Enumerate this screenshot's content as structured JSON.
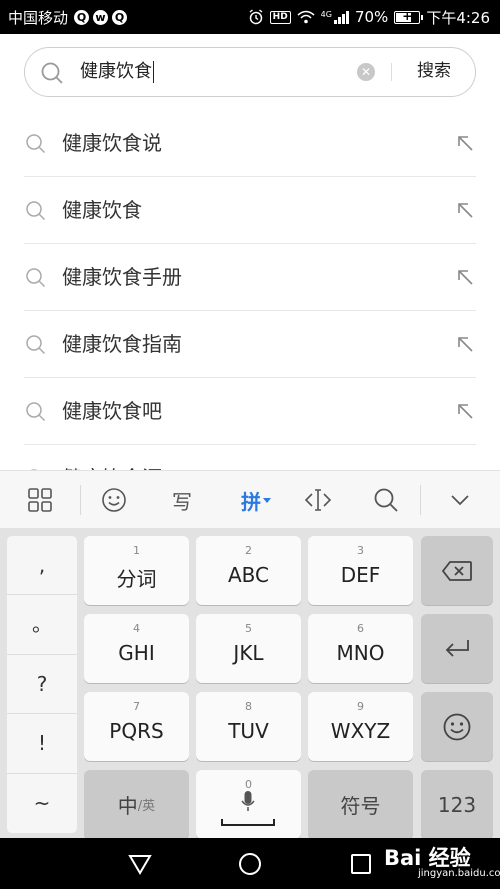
{
  "status_bar": {
    "carrier": "中国移动",
    "battery": "70%",
    "battery_level": 0.7,
    "time": "下午4:26",
    "hd_label": "HD",
    "signal_label": "4G"
  },
  "search": {
    "query": "健康饮食",
    "submit_label": "搜索"
  },
  "suggestions": [
    "健康饮食说",
    "健康饮食",
    "健康饮食手册",
    "健康饮食指南",
    "健康饮食吧",
    "健康饮食源"
  ],
  "keyboard": {
    "toolbar": {
      "handwrite_label": "写",
      "pinyin_label": "拼"
    },
    "punctuation": [
      ",",
      "。",
      "?",
      "!",
      "~"
    ],
    "keys": [
      {
        "num": "1",
        "label": "分词"
      },
      {
        "num": "2",
        "label": "ABC"
      },
      {
        "num": "3",
        "label": "DEF"
      },
      {
        "num": "4",
        "label": "GHI"
      },
      {
        "num": "5",
        "label": "JKL"
      },
      {
        "num": "6",
        "label": "MNO"
      },
      {
        "num": "7",
        "label": "PQRS"
      },
      {
        "num": "8",
        "label": "TUV"
      },
      {
        "num": "9",
        "label": "WXYZ"
      }
    ],
    "lang_zh": "中",
    "lang_en": "/英",
    "space_num": "0",
    "symbol_label": "符号",
    "numeric_label": "123"
  },
  "watermark": {
    "brand": "Bai 经验",
    "url": "jingyan.baidu.com"
  }
}
